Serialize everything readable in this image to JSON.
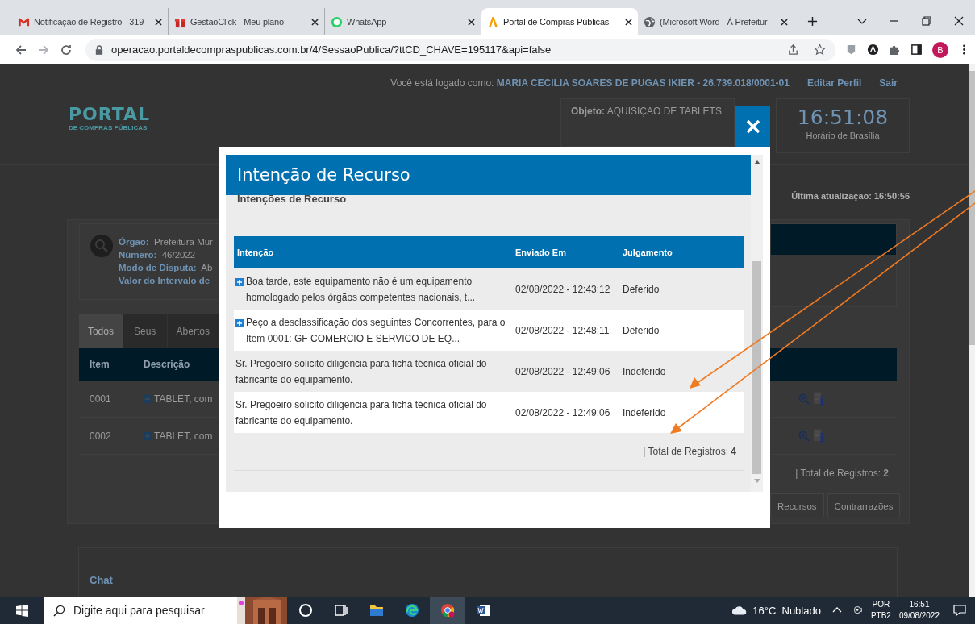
{
  "browser": {
    "tabs": [
      {
        "kind": "mail",
        "title": "Notificação de Registro - 319",
        "selected": false
      },
      {
        "kind": "gift",
        "title": "GestãoClick - Meu plano",
        "selected": false
      },
      {
        "kind": "chat",
        "title": "WhatsApp",
        "selected": false
      },
      {
        "kind": "portal",
        "title": "Portal de Compras Públicas",
        "selected": true
      },
      {
        "kind": "globe",
        "title": "(Microsoft Word - Á Prefeitur",
        "selected": false
      }
    ],
    "url": "operacao.portaldecompraspublicas.com.br/4/SessaoPublica/?ttCD_CHAVE=195117&api=false",
    "avatar": "B"
  },
  "header": {
    "login_label": "Você está logado como:",
    "login_user": "MARIA CECILIA SOARES DE PUGAS IKIER - 26.739.018/0001-01",
    "links": [
      "Editar Perfil",
      "Sair"
    ],
    "logo": "PORTAL",
    "logo_subtitle": "DE COMPRAS PÚBLICAS",
    "objeto_label": "Objeto:",
    "objeto_value": "AQUISIÇÃO DE TABLETS",
    "clock": "16:51:08",
    "clock_caption": "Horário de Brasília"
  },
  "last_update": "Última atualização: 16:50:56",
  "process_info": [
    {
      "label": "Órgão:",
      "value": "Prefeitura Mur"
    },
    {
      "label": "Número:",
      "value": "46/2022"
    },
    {
      "label": "Modo de Disputa:",
      "value": "Ab"
    },
    {
      "label": "Valor do Intervalo de"
    }
  ],
  "item_tabs": [
    {
      "label": "Todos",
      "selected": true
    },
    {
      "label": "Seus",
      "selected": false
    },
    {
      "label": "Abertos",
      "selected": false
    }
  ],
  "items_table": {
    "columns": [
      "Item",
      "Descrição"
    ],
    "rows": [
      {
        "item": "0001",
        "description": "TABLET, com"
      },
      {
        "item": "0002",
        "description": "TABLET, com"
      }
    ],
    "total": "| Total de Registros: **2**"
  },
  "action_buttons": [
    "Recursos",
    "Contrarrazões"
  ],
  "chat": {
    "title": "Chat"
  },
  "modal": {
    "title": "Intenção de Recurso",
    "section_title": "Intenções de Recurso",
    "columns": [
      "Intenção",
      "Enviado Em",
      "Julgamento"
    ],
    "rows": [
      {
        "intencao": "Boa tarde, este equipamento não é um equipamento homologado pelos órgãos competentes nacionais, t...",
        "enviado_em": "02/08/2022 - 12:43:12",
        "julgamento": "Deferido",
        "expandable": true
      },
      {
        "intencao": "Peço a desclassificação dos seguintes Concorrentes, para o Item 0001: GF COMERCIO E SERVICO DE EQ...",
        "enviado_em": "02/08/2022 - 12:48:11",
        "julgamento": "Deferido",
        "expandable": true
      },
      {
        "intencao": "Sr. Pregoeiro solicito diligencia para ficha técnica oficial do fabricante do equipamento.",
        "enviado_em": "02/08/2022 - 12:49:06",
        "julgamento": "Indeferido",
        "expandable": false
      },
      {
        "intencao": "Sr. Pregoeiro solicito diligencia para ficha técnica oficial do fabricante do equipamento.",
        "enviado_em": "02/08/2022 - 12:49:06",
        "julgamento": "Indeferido",
        "expandable": false
      }
    ],
    "total": "| Total de Registros: **4**"
  },
  "taskbar": {
    "search_placeholder": "Digite aqui para pesquisar",
    "apps": [
      {
        "kind": "cortana",
        "active": false
      },
      {
        "kind": "taskview",
        "active": false
      },
      {
        "kind": "folder",
        "active": false
      },
      {
        "kind": "edge",
        "active": false
      },
      {
        "kind": "chrome",
        "active": true
      },
      {
        "kind": "word",
        "active": false
      }
    ],
    "weather": "16°C  Nublado",
    "language": "POR",
    "keyboard": "PTB2",
    "time": "16:51",
    "date": "09/08/2022"
  }
}
